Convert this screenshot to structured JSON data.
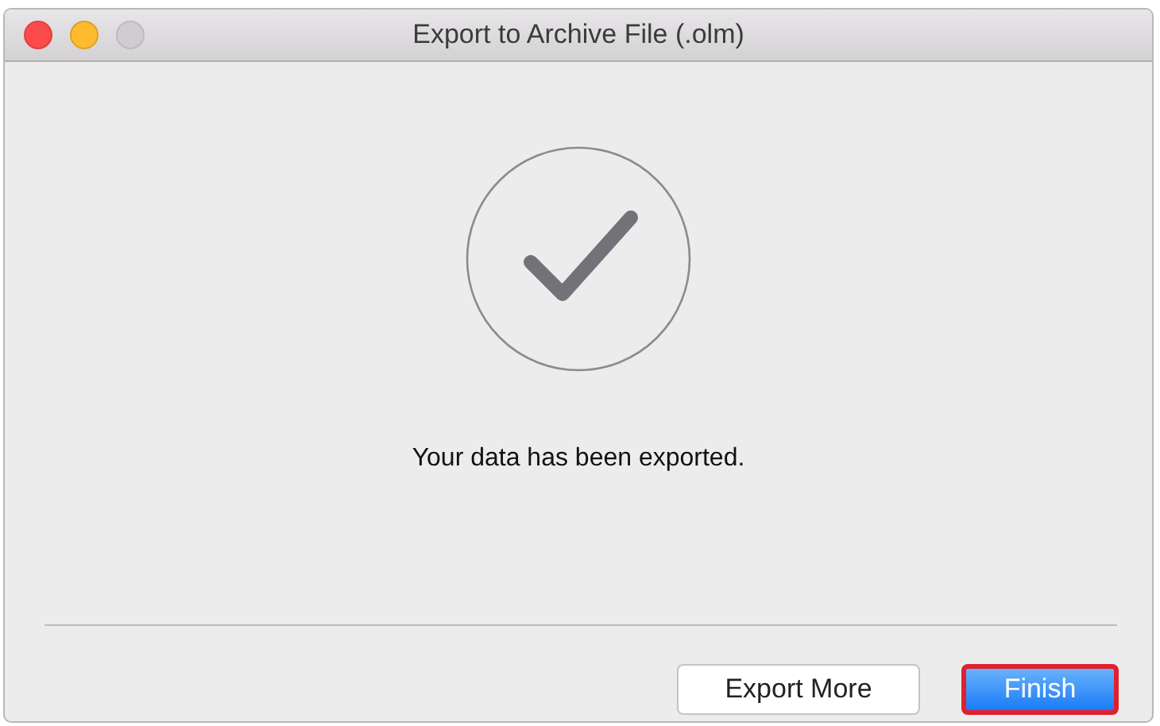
{
  "window": {
    "title": "Export to Archive File (.olm)",
    "zoom_disabled": true
  },
  "message": "Your data has been exported.",
  "buttons": [
    {
      "label": "Export More",
      "kind": "default",
      "highlighted": false
    },
    {
      "label": "Finish",
      "kind": "primary",
      "highlighted": true
    }
  ]
}
